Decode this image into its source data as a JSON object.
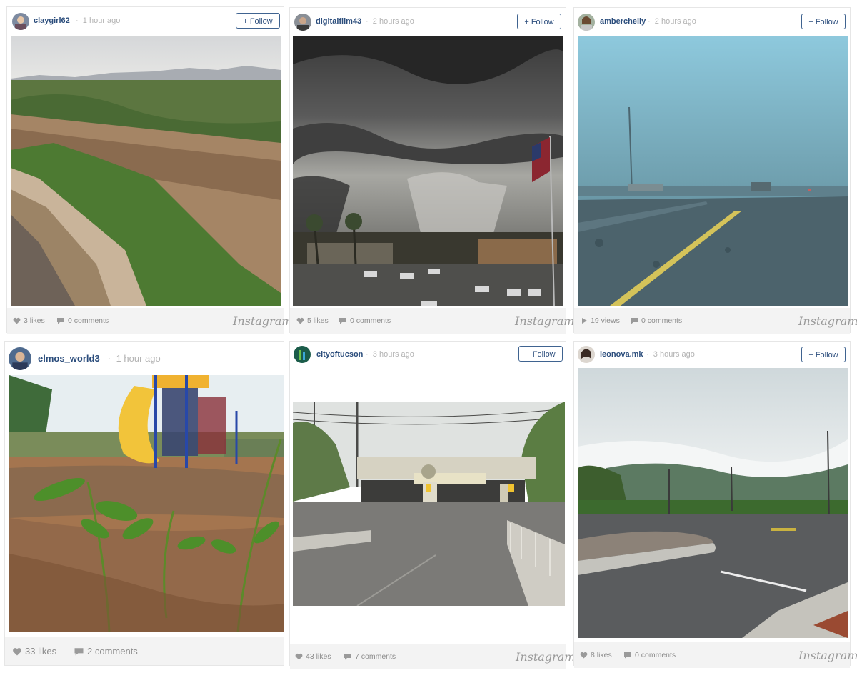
{
  "posts": [
    {
      "username": "claygirl62",
      "time": "1 hour ago",
      "follow": "+ Follow",
      "stat1": "3 likes",
      "stat2": "0 comments",
      "brand": "Instagram"
    },
    {
      "username": "digitalfilm43",
      "time": "2 hours ago",
      "follow": "+ Follow",
      "stat1": "5 likes",
      "stat2": "0 comments",
      "brand": "Instagram"
    },
    {
      "username": "amberchelly",
      "time": "2 hours ago",
      "follow": "+ Follow",
      "stat1": "19 views",
      "stat2": "0 comments",
      "brand": "Instagram"
    },
    {
      "username": "elmos_world3",
      "time": "1 hour ago",
      "stat1": "33 likes",
      "stat2": "2 comments"
    },
    {
      "username": "cityoftucson",
      "time": "3 hours ago",
      "follow": "+ Follow",
      "stat1": "43 likes",
      "stat2": "7 comments",
      "brand": "Instagram"
    },
    {
      "username": "leonova.mk",
      "time": "3 hours ago",
      "follow": "+ Follow",
      "stat1": "8 likes",
      "stat2": "0 comments",
      "brand": "Instagram"
    }
  ],
  "separator": "·",
  "colors": {
    "username": "#2b4d7c",
    "muted": "#8c8c8c",
    "footer_bg": "#f3f3f3",
    "follow_border": "#3f6390"
  },
  "icons": {
    "like": "heart-icon",
    "comment": "speech-bubble-icon",
    "views": "play-icon"
  }
}
